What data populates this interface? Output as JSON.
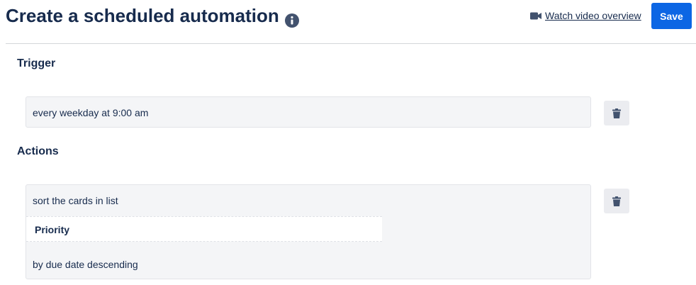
{
  "header": {
    "title": "Create a scheduled automation",
    "video_link": "Watch video overview",
    "save_label": "Save"
  },
  "trigger": {
    "heading": "Trigger",
    "text": "every weekday at 9:00 am"
  },
  "actions": {
    "heading": "Actions",
    "text_before": "sort the cards in list",
    "list_value": "Priority",
    "text_after": "by due date descending"
  },
  "icons": {
    "info": "info-circle-icon",
    "video": "video-camera-icon",
    "delete": "trash-icon"
  },
  "colors": {
    "accent": "#0c66e4",
    "text": "#172b4d",
    "card_bg": "#f4f5f7",
    "button_bg": "#ebecf0"
  }
}
